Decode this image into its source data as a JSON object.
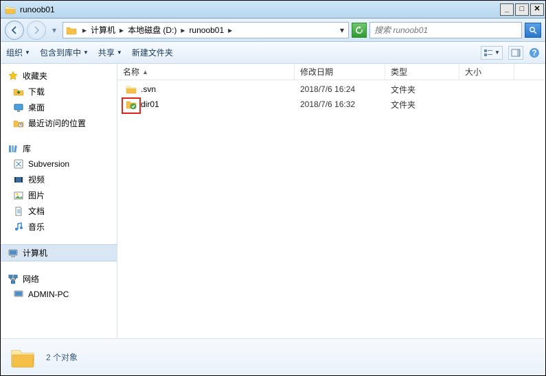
{
  "window": {
    "title": "runoob01"
  },
  "nav": {
    "crumbs": [
      "计算机",
      "本地磁盘 (D:)",
      "runoob01"
    ],
    "search_placeholder": "搜索 runoob01"
  },
  "toolbar": {
    "organize": "组织",
    "include": "包含到库中",
    "share": "共享",
    "newfolder": "新建文件夹"
  },
  "sidebar": {
    "favorites": {
      "label": "收藏夹",
      "items": [
        "下载",
        "桌面",
        "最近访问的位置"
      ]
    },
    "libraries": {
      "label": "库",
      "items": [
        "Subversion",
        "视频",
        "图片",
        "文档",
        "音乐"
      ]
    },
    "computer": {
      "label": "计算机"
    },
    "network": {
      "label": "网络",
      "items": [
        "ADMIN-PC"
      ]
    }
  },
  "columns": {
    "name": "名称",
    "date": "修改日期",
    "type": "类型",
    "size": "大小"
  },
  "files": [
    {
      "name": ".svn",
      "date": "2018/7/6 16:24",
      "type": "文件夹"
    },
    {
      "name": "dir01",
      "date": "2018/7/6 16:32",
      "type": "文件夹"
    }
  ],
  "status": {
    "text": "2 个对象"
  }
}
